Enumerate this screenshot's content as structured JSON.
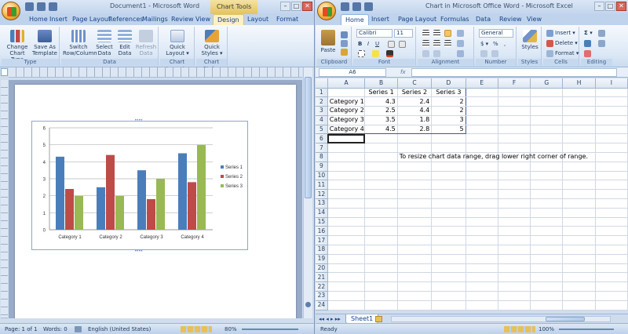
{
  "word": {
    "title": "Document1 - Microsoft Word",
    "context_tab_group": "Chart Tools",
    "tabs": [
      "Home",
      "Insert",
      "Page Layout",
      "References",
      "Mailings",
      "Review",
      "View",
      "Design",
      "Layout",
      "Format"
    ],
    "active_tab": "Design",
    "ribbon": {
      "type_group": {
        "label": "Type",
        "change_chart_type": "Change Chart Type",
        "save_as_template": "Save As Template"
      },
      "data_group": {
        "label": "Data",
        "switch_row_column": "Switch Row/Column",
        "select_data": "Select Data",
        "edit_data": "Edit Data",
        "refresh_data": "Refresh Data"
      },
      "chart_layouts_group": {
        "label": "Chart Layouts",
        "quick_layout": "Quick Layout"
      },
      "chart_styles_group": {
        "label": "Chart Styles",
        "quick_styles": "Quick Styles"
      }
    },
    "status": {
      "page": "Page: 1 of 1",
      "words": "Words: 0",
      "language": "English (United States)",
      "zoom": "80%"
    }
  },
  "chart_data": {
    "type": "bar",
    "categories": [
      "Category 1",
      "Category 2",
      "Category 3",
      "Category 4"
    ],
    "series": [
      {
        "name": "Series 1",
        "values": [
          4.3,
          2.5,
          3.5,
          4.5
        ],
        "color": "#4a7ebb"
      },
      {
        "name": "Series 2",
        "values": [
          2.4,
          4.4,
          1.8,
          2.8
        ],
        "color": "#be4b48"
      },
      {
        "name": "Series 3",
        "values": [
          2,
          2,
          3,
          5
        ],
        "color": "#98b954"
      }
    ],
    "yticks": [
      "0",
      "1",
      "2",
      "3",
      "4",
      "5",
      "6"
    ],
    "ylim": [
      0,
      6
    ],
    "grid": true,
    "legend": "right"
  },
  "excel": {
    "title": "Chart in Microsoft Office Word - Microsoft Excel",
    "tabs": [
      "Home",
      "Insert",
      "Page Layout",
      "Formulas",
      "Data",
      "Review",
      "View"
    ],
    "active_tab": "Home",
    "ribbon": {
      "clipboard": {
        "label": "Clipboard",
        "paste": "Paste"
      },
      "font": {
        "label": "Font",
        "name": "Calibri",
        "size": "11"
      },
      "alignment": {
        "label": "Alignment"
      },
      "number": {
        "label": "Number",
        "format": "General"
      },
      "styles": {
        "label": "Styles",
        "button": "Styles"
      },
      "cells": {
        "label": "Cells",
        "insert": "Insert",
        "delete": "Delete",
        "format": "Format"
      },
      "editing": {
        "label": "Editing"
      }
    },
    "name_box": "A6",
    "fx": "fx",
    "columns": [
      "A",
      "B",
      "C",
      "D",
      "E",
      "F",
      "G",
      "H",
      "I"
    ],
    "rows": [
      [
        "",
        "Series 1",
        "Series 2",
        "Series 3",
        "",
        "",
        "",
        "",
        ""
      ],
      [
        "Category 1",
        "4.3",
        "2.4",
        "2",
        "",
        "",
        "",
        "",
        ""
      ],
      [
        "Category 2",
        "2.5",
        "4.4",
        "2",
        "",
        "",
        "",
        "",
        ""
      ],
      [
        "Category 3",
        "3.5",
        "1.8",
        "3",
        "",
        "",
        "",
        "",
        ""
      ],
      [
        "Category 4",
        "4.5",
        "2.8",
        "5",
        "",
        "",
        "",
        "",
        ""
      ],
      [
        "",
        "",
        "",
        "",
        "",
        "",
        "",
        "",
        ""
      ],
      [
        "",
        "",
        "",
        "",
        "",
        "",
        "",
        "",
        ""
      ],
      [
        "",
        "",
        "To resize chart data range, drag lower right corner of range.",
        "",
        "",
        "",
        "",
        "",
        ""
      ],
      [
        "",
        "",
        "",
        "",
        "",
        "",
        "",
        "",
        ""
      ],
      [
        "",
        "",
        "",
        "",
        "",
        "",
        "",
        "",
        ""
      ],
      [
        "",
        "",
        "",
        "",
        "",
        "",
        "",
        "",
        ""
      ],
      [
        "",
        "",
        "",
        "",
        "",
        "",
        "",
        "",
        ""
      ],
      [
        "",
        "",
        "",
        "",
        "",
        "",
        "",
        "",
        ""
      ],
      [
        "",
        "",
        "",
        "",
        "",
        "",
        "",
        "",
        ""
      ],
      [
        "",
        "",
        "",
        "",
        "",
        "",
        "",
        "",
        ""
      ],
      [
        "",
        "",
        "",
        "",
        "",
        "",
        "",
        "",
        ""
      ],
      [
        "",
        "",
        "",
        "",
        "",
        "",
        "",
        "",
        ""
      ],
      [
        "",
        "",
        "",
        "",
        "",
        "",
        "",
        "",
        ""
      ],
      [
        "",
        "",
        "",
        "",
        "",
        "",
        "",
        "",
        ""
      ],
      [
        "",
        "",
        "",
        "",
        "",
        "",
        "",
        "",
        ""
      ],
      [
        "",
        "",
        "",
        "",
        "",
        "",
        "",
        "",
        ""
      ],
      [
        "",
        "",
        "",
        "",
        "",
        "",
        "",
        "",
        ""
      ],
      [
        "",
        "",
        "",
        "",
        "",
        "",
        "",
        "",
        ""
      ],
      [
        "",
        "",
        "",
        "",
        "",
        "",
        "",
        "",
        ""
      ]
    ],
    "sheet_tab": "Sheet1",
    "status": {
      "ready": "Ready",
      "zoom": "100%"
    }
  }
}
